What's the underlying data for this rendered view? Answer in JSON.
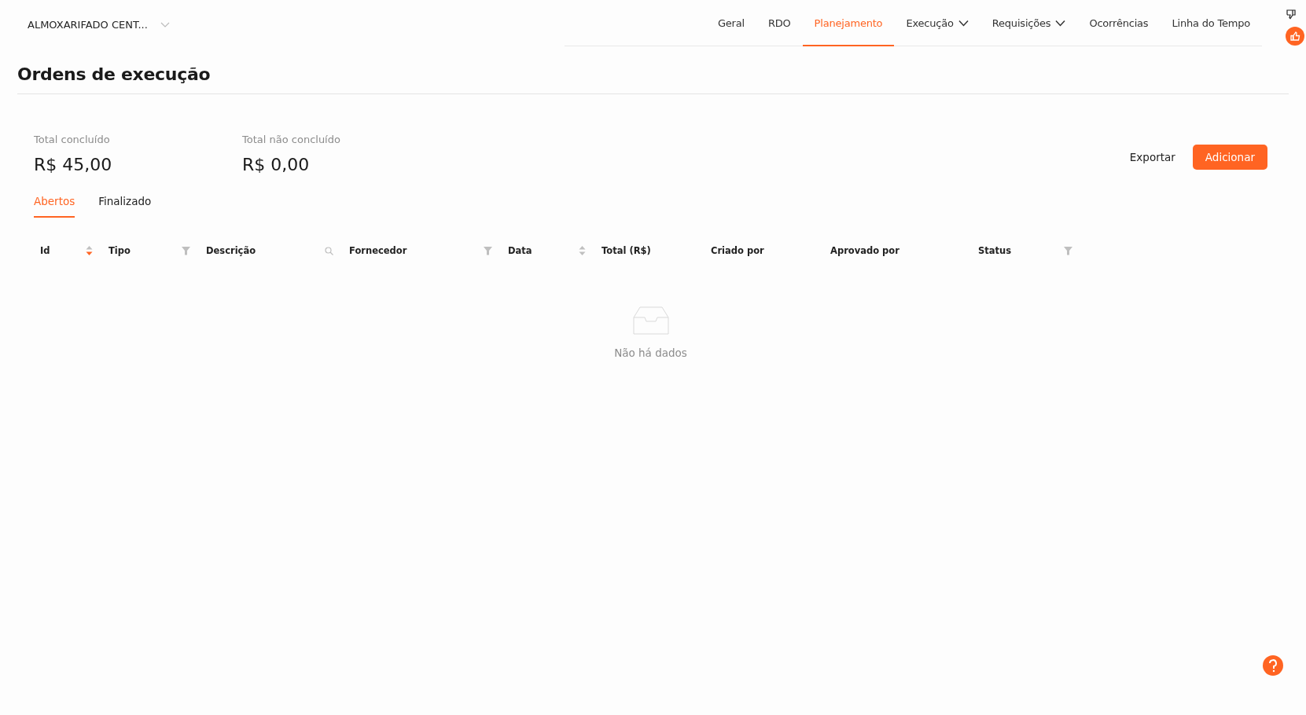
{
  "project_selector": {
    "label": "ALMOXARIFADO CENT..."
  },
  "nav": [
    {
      "label": "Geral",
      "selected": false,
      "dropdown": false
    },
    {
      "label": "RDO",
      "selected": false,
      "dropdown": false
    },
    {
      "label": "Planejamento",
      "selected": true,
      "dropdown": false
    },
    {
      "label": "Execução",
      "selected": false,
      "dropdown": true
    },
    {
      "label": "Requisições",
      "selected": false,
      "dropdown": true
    },
    {
      "label": "Ocorrências",
      "selected": false,
      "dropdown": false
    },
    {
      "label": "Linha do Tempo",
      "selected": false,
      "dropdown": false
    }
  ],
  "page_title": "Ordens de execução",
  "totals": [
    {
      "label": "Total concluído",
      "value": "R$ 45,00"
    },
    {
      "label": "Total não concluído",
      "value": "R$ 0,00"
    }
  ],
  "actions": {
    "export": "Exportar",
    "add": "Adicionar"
  },
  "tabs": [
    {
      "label": "Abertos",
      "selected": true
    },
    {
      "label": "Finalizado",
      "selected": false
    }
  ],
  "table": {
    "columns": [
      {
        "label": "Id",
        "kind": "sort",
        "sorted_descending": true
      },
      {
        "label": "Tipo",
        "kind": "filter"
      },
      {
        "label": "Descrição",
        "kind": "search"
      },
      {
        "label": "Fornecedor",
        "kind": "filter"
      },
      {
        "label": "Data",
        "kind": "sort",
        "sorted_descending": false
      },
      {
        "label": "Total (R$)",
        "kind": "plain"
      },
      {
        "label": "Criado por",
        "kind": "plain"
      },
      {
        "label": "Aprovado por",
        "kind": "plain"
      },
      {
        "label": "Status",
        "kind": "filter"
      }
    ],
    "empty_text": "Não há dados"
  }
}
